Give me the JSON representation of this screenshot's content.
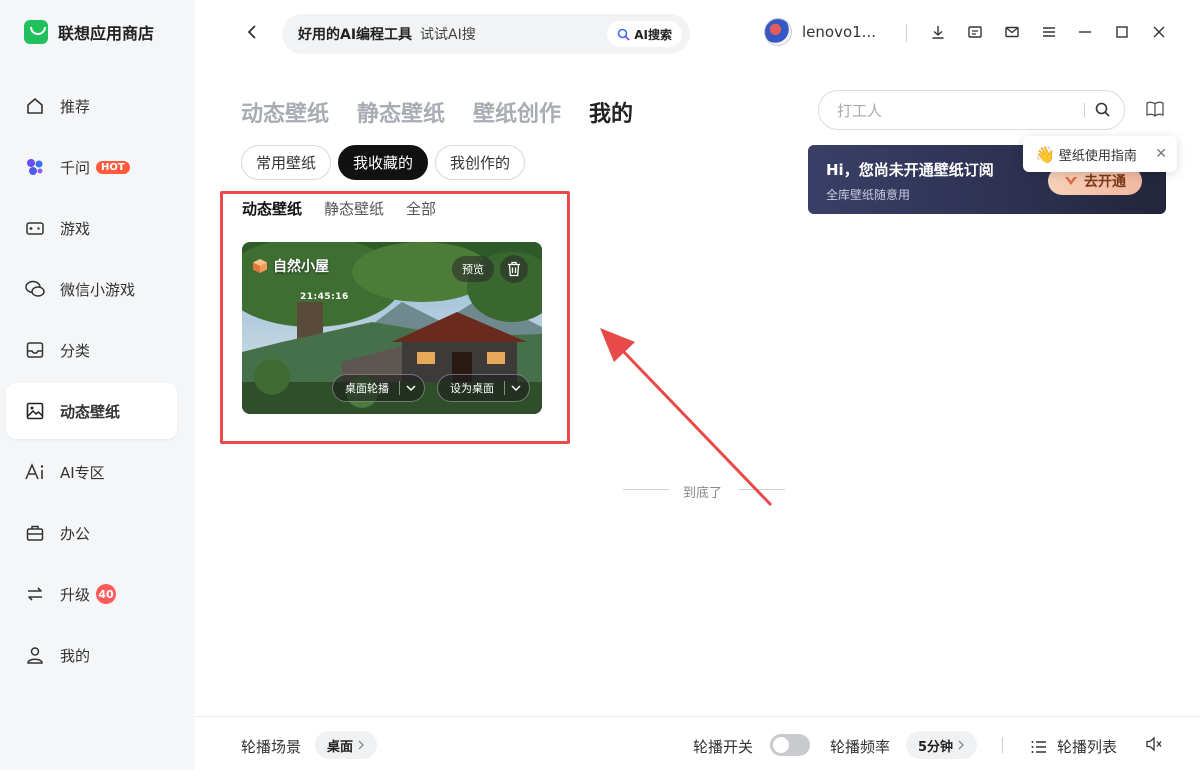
{
  "app": {
    "name": "联想应用商店"
  },
  "sidebar": {
    "items": [
      {
        "label": "推荐",
        "icon": "home-icon"
      },
      {
        "label": "千问",
        "icon": "qianwen-icon",
        "badge": "HOT"
      },
      {
        "label": "游戏",
        "icon": "gamepad-icon"
      },
      {
        "label": "微信小游戏",
        "icon": "wechat-icon"
      },
      {
        "label": "分类",
        "icon": "category-icon"
      },
      {
        "label": "动态壁纸",
        "icon": "image-icon",
        "active": true
      },
      {
        "label": "AI专区",
        "icon": "ai-icon"
      },
      {
        "label": "办公",
        "icon": "briefcase-icon"
      },
      {
        "label": "升级",
        "icon": "sync-icon",
        "badge": "40"
      },
      {
        "label": "我的",
        "icon": "user-icon"
      }
    ]
  },
  "topbar": {
    "search_highlight": "好用的AI编程工具",
    "search_hint": "试试AI搜",
    "ai_search_label": "AI搜索",
    "username": "lenovo1..."
  },
  "category_tabs": [
    {
      "label": "动态壁纸",
      "active": false
    },
    {
      "label": "静态壁纸",
      "active": false
    },
    {
      "label": "壁纸创作",
      "active": false
    },
    {
      "label": "我的",
      "active": true
    }
  ],
  "wallpaper_search": {
    "placeholder": "打工人"
  },
  "sub_tabs": [
    {
      "label": "常用壁纸",
      "active": false
    },
    {
      "label": "我收藏的",
      "active": true
    },
    {
      "label": "我创作的",
      "active": false
    }
  ],
  "promo": {
    "title": "Hi，您尚未开通壁纸订阅",
    "subtitle": "全库壁纸随意用",
    "button": "去开通"
  },
  "tooltip": {
    "text": "壁纸使用指南"
  },
  "filter_tabs": [
    {
      "label": "动态壁纸",
      "active": true
    },
    {
      "label": "静态壁纸",
      "active": false
    },
    {
      "label": "全部",
      "active": false
    }
  ],
  "wallpaper_card": {
    "title": "自然小屋",
    "clock": "21:45:16",
    "preview_label": "预览",
    "carousel_label": "桌面轮播",
    "set_desktop_label": "设为桌面"
  },
  "end_text": "到底了",
  "bottom_bar": {
    "scene_label": "轮播场景",
    "scene_value": "桌面",
    "switch_label": "轮播开关",
    "switch_on": false,
    "frequency_label": "轮播频率",
    "frequency_value": "5分钟",
    "list_label": "轮播列表"
  },
  "colors": {
    "accent_red": "#e84a4a",
    "brand_green": "#20c05c",
    "hot_badge": "#ff5a3c"
  }
}
